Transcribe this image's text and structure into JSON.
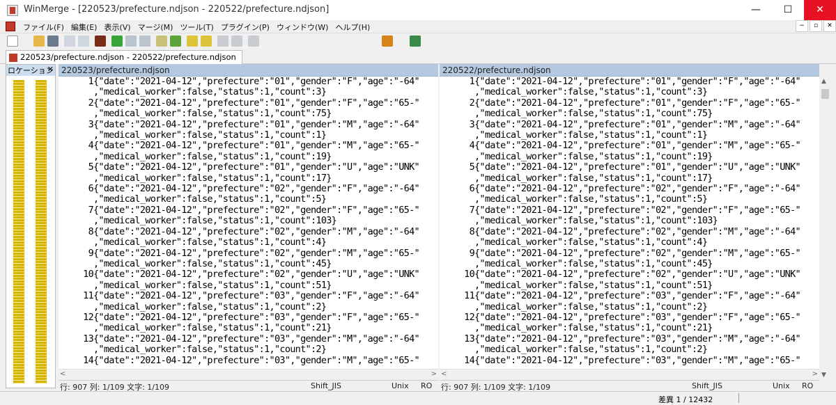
{
  "window": {
    "title": "WinMerge - [220523/prefecture.ndjson - 220522/prefecture.ndjson]",
    "minimize": "—",
    "maximize": "☐",
    "close": "✕"
  },
  "menu": [
    "ファイル(F)",
    "編集(E)",
    "表示(V)",
    "マージ(M)",
    "ツール(T)",
    "プラグイン(P)",
    "ウィンドウ(W)",
    "ヘルプ(H)"
  ],
  "mdi_buttons": [
    "−",
    "▫",
    "✕"
  ],
  "tab": {
    "label": "220523/prefecture.ndjson - 220522/prefecture.ndjson"
  },
  "location_pane": {
    "title": "ロケーション /",
    "close": "✕"
  },
  "left_pane": {
    "header": "220523/prefecture.ndjson",
    "lines": [
      {
        "num": "1",
        "text": "{\"date\":\"2021-04-12\",\"prefecture\":\"01\",\"gender\":\"F\",\"age\":\"-64\""
      },
      {
        "num": "",
        "text": ",\"medical_worker\":false,\"status\":1,\"count\":3}"
      },
      {
        "num": "2",
        "text": "{\"date\":\"2021-04-12\",\"prefecture\":\"01\",\"gender\":\"F\",\"age\":\"65-\""
      },
      {
        "num": "",
        "text": ",\"medical_worker\":false,\"status\":1,\"count\":75}"
      },
      {
        "num": "3",
        "text": "{\"date\":\"2021-04-12\",\"prefecture\":\"01\",\"gender\":\"M\",\"age\":\"-64\""
      },
      {
        "num": "",
        "text": ",\"medical_worker\":false,\"status\":1,\"count\":1}"
      },
      {
        "num": "4",
        "text": "{\"date\":\"2021-04-12\",\"prefecture\":\"01\",\"gender\":\"M\",\"age\":\"65-\""
      },
      {
        "num": "",
        "text": ",\"medical_worker\":false,\"status\":1,\"count\":19}"
      },
      {
        "num": "5",
        "text": "{\"date\":\"2021-04-12\",\"prefecture\":\"01\",\"gender\":\"U\",\"age\":\"UNK\""
      },
      {
        "num": "",
        "text": ",\"medical_worker\":false,\"status\":1,\"count\":17}"
      },
      {
        "num": "6",
        "text": "{\"date\":\"2021-04-12\",\"prefecture\":\"02\",\"gender\":\"F\",\"age\":\"-64\""
      },
      {
        "num": "",
        "text": ",\"medical_worker\":false,\"status\":1,\"count\":5}"
      },
      {
        "num": "7",
        "text": "{\"date\":\"2021-04-12\",\"prefecture\":\"02\",\"gender\":\"F\",\"age\":\"65-\""
      },
      {
        "num": "",
        "text": ",\"medical_worker\":false,\"status\":1,\"count\":103}"
      },
      {
        "num": "8",
        "text": "{\"date\":\"2021-04-12\",\"prefecture\":\"02\",\"gender\":\"M\",\"age\":\"-64\""
      },
      {
        "num": "",
        "text": ",\"medical_worker\":false,\"status\":1,\"count\":4}"
      },
      {
        "num": "9",
        "text": "{\"date\":\"2021-04-12\",\"prefecture\":\"02\",\"gender\":\"M\",\"age\":\"65-\""
      },
      {
        "num": "",
        "text": ",\"medical_worker\":false,\"status\":1,\"count\":45}"
      },
      {
        "num": "10",
        "text": "{\"date\":\"2021-04-12\",\"prefecture\":\"02\",\"gender\":\"U\",\"age\":\"UNK\""
      },
      {
        "num": "",
        "text": ",\"medical_worker\":false,\"status\":1,\"count\":51}"
      },
      {
        "num": "11",
        "text": "{\"date\":\"2021-04-12\",\"prefecture\":\"03\",\"gender\":\"F\",\"age\":\"-64\""
      },
      {
        "num": "",
        "text": ",\"medical_worker\":false,\"status\":1,\"count\":2}"
      },
      {
        "num": "12",
        "text": "{\"date\":\"2021-04-12\",\"prefecture\":\"03\",\"gender\":\"F\",\"age\":\"65-\""
      },
      {
        "num": "",
        "text": ",\"medical_worker\":false,\"status\":1,\"count\":21}"
      },
      {
        "num": "13",
        "text": "{\"date\":\"2021-04-12\",\"prefecture\":\"03\",\"gender\":\"M\",\"age\":\"-64\""
      },
      {
        "num": "",
        "text": ",\"medical_worker\":false,\"status\":1,\"count\":2}"
      },
      {
        "num": "14",
        "text": "{\"date\":\"2021-04-12\",\"prefecture\":\"03\",\"gender\":\"M\",\"age\":\"65-\""
      }
    ],
    "status": {
      "pos": "行: 907  列: 1/109  文字: 1/109",
      "encoding": "Shift_JIS",
      "eol": "Unix",
      "ro": "RO"
    }
  },
  "right_pane": {
    "header": "220522/prefecture.ndjson",
    "lines": [
      {
        "num": "1",
        "text": "{\"date\":\"2021-04-12\",\"prefecture\":\"01\",\"gender\":\"F\",\"age\":\"-64\""
      },
      {
        "num": "",
        "text": ",\"medical_worker\":false,\"status\":1,\"count\":3}"
      },
      {
        "num": "2",
        "text": "{\"date\":\"2021-04-12\",\"prefecture\":\"01\",\"gender\":\"F\",\"age\":\"65-\""
      },
      {
        "num": "",
        "text": ",\"medical_worker\":false,\"status\":1,\"count\":75}"
      },
      {
        "num": "3",
        "text": "{\"date\":\"2021-04-12\",\"prefecture\":\"01\",\"gender\":\"M\",\"age\":\"-64\""
      },
      {
        "num": "",
        "text": ",\"medical_worker\":false,\"status\":1,\"count\":1}"
      },
      {
        "num": "4",
        "text": "{\"date\":\"2021-04-12\",\"prefecture\":\"01\",\"gender\":\"M\",\"age\":\"65-\""
      },
      {
        "num": "",
        "text": ",\"medical_worker\":false,\"status\":1,\"count\":19}"
      },
      {
        "num": "5",
        "text": "{\"date\":\"2021-04-12\",\"prefecture\":\"01\",\"gender\":\"U\",\"age\":\"UNK\""
      },
      {
        "num": "",
        "text": ",\"medical_worker\":false,\"status\":1,\"count\":17}"
      },
      {
        "num": "6",
        "text": "{\"date\":\"2021-04-12\",\"prefecture\":\"02\",\"gender\":\"F\",\"age\":\"-64\""
      },
      {
        "num": "",
        "text": ",\"medical_worker\":false,\"status\":1,\"count\":5}"
      },
      {
        "num": "7",
        "text": "{\"date\":\"2021-04-12\",\"prefecture\":\"02\",\"gender\":\"F\",\"age\":\"65-\""
      },
      {
        "num": "",
        "text": ",\"medical_worker\":false,\"status\":1,\"count\":103}"
      },
      {
        "num": "8",
        "text": "{\"date\":\"2021-04-12\",\"prefecture\":\"02\",\"gender\":\"M\",\"age\":\"-64\""
      },
      {
        "num": "",
        "text": ",\"medical_worker\":false,\"status\":1,\"count\":4}"
      },
      {
        "num": "9",
        "text": "{\"date\":\"2021-04-12\",\"prefecture\":\"02\",\"gender\":\"M\",\"age\":\"65-\""
      },
      {
        "num": "",
        "text": ",\"medical_worker\":false,\"status\":1,\"count\":45}"
      },
      {
        "num": "10",
        "text": "{\"date\":\"2021-04-12\",\"prefecture\":\"02\",\"gender\":\"U\",\"age\":\"UNK\""
      },
      {
        "num": "",
        "text": ",\"medical_worker\":false,\"status\":1,\"count\":51}"
      },
      {
        "num": "11",
        "text": "{\"date\":\"2021-04-12\",\"prefecture\":\"03\",\"gender\":\"F\",\"age\":\"-64\""
      },
      {
        "num": "",
        "text": ",\"medical_worker\":false,\"status\":1,\"count\":2}"
      },
      {
        "num": "12",
        "text": "{\"date\":\"2021-04-12\",\"prefecture\":\"03\",\"gender\":\"F\",\"age\":\"65-\""
      },
      {
        "num": "",
        "text": ",\"medical_worker\":false,\"status\":1,\"count\":21}"
      },
      {
        "num": "13",
        "text": "{\"date\":\"2021-04-12\",\"prefecture\":\"03\",\"gender\":\"M\",\"age\":\"-64\""
      },
      {
        "num": "",
        "text": ",\"medical_worker\":false,\"status\":1,\"count\":2}"
      },
      {
        "num": "14",
        "text": "{\"date\":\"2021-04-12\",\"prefecture\":\"03\",\"gender\":\"M\",\"age\":\"65-\""
      }
    ],
    "status": {
      "pos": "行: 907  列: 1/109  文字: 1/109",
      "encoding": "Shift_JIS",
      "eol": "Unix",
      "ro": "RO"
    }
  },
  "bottom_status": {
    "diff": "差異 1 / 12432"
  },
  "colors": {
    "accent_close": "#e81123",
    "pane_header": "#b4c8df",
    "location_bar": "#d4b400"
  },
  "toolbar_icons": [
    "new-icon",
    "open-icon",
    "save-icon",
    "undo-icon",
    "redo-icon",
    "print-icon",
    "copy-left-icon",
    "copy-right-icon",
    "copy-all-icon",
    "merge-icon",
    "merge-all-icon",
    "next-diff-icon",
    "prev-diff-icon",
    "first-diff-icon",
    "last-diff-icon",
    "current-diff-icon",
    "options-icon",
    "refresh-icon"
  ]
}
